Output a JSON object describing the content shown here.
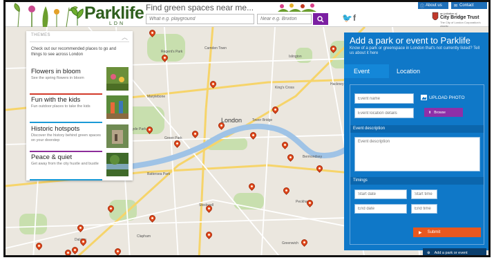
{
  "header": {
    "logo": {
      "word": "Parklife",
      "sub": "LDN"
    },
    "find_label": "Find green spaces near me...",
    "search_placeholder": "What e.g. playground",
    "near_placeholder": "Near e.g. Brixton",
    "about_label": "About us",
    "contact_label": "Contact",
    "trust": {
      "small": "an initiative of",
      "name": "City Bridge Trust",
      "tag": "The City of London Corporation's charity"
    }
  },
  "map": {
    "labels": [
      "Camden Town",
      "Regent's Park",
      "Islington",
      "Marylebone",
      "London",
      "Hackney",
      "Green Park",
      "Hyde Park",
      "Tower Bridge",
      "Bermondsey",
      "Peckham",
      "Battersea Park",
      "Stockwell",
      "Clapham",
      "Dalston",
      "King's Cross",
      "Greenwich"
    ]
  },
  "themes": {
    "heading": "THEMES",
    "intro": "Check out our recommended places to go and things to see across London",
    "items": [
      {
        "title": "Flowers in bloom",
        "subtitle": "See the spring flowers in bloom",
        "color": "#d23a2a"
      },
      {
        "title": "Fun with the kids",
        "subtitle": "Fun outdoor places to take the kids",
        "color": "#1a9ad6"
      },
      {
        "title": "Historic hotspots",
        "subtitle": "Discover the history behind green spaces on your doorstep",
        "color": "#8c2d9a"
      },
      {
        "title": "Peace & quiet",
        "subtitle": "Get away from the city hustle and bustle",
        "color": "#1a9ad6"
      }
    ]
  },
  "panel": {
    "title": "Add a park or event to Parklife",
    "desc": "Know of a park or greenspace in London that's not currently listed? Tell us about it here",
    "tabs": [
      "Event",
      "Location"
    ],
    "event_name": "Event name",
    "location_details": "Event location details",
    "upload_label": "UPLOAD PHOTO",
    "browse_label": "Browse",
    "desc_section": "Event description",
    "desc_placeholder": "Event description",
    "timings_section": "Timings",
    "start_date": "Start date",
    "start_time": "Start time",
    "end_date": "End date",
    "end_time": "End time",
    "submit_label": "Submit"
  },
  "add_bar": {
    "label": "Add a park or event"
  },
  "colors": {
    "brand_blue": "#0f78c8",
    "search_purple": "#7b1fa2",
    "submit_orange": "#e8581f",
    "pin": "#e2471c"
  }
}
